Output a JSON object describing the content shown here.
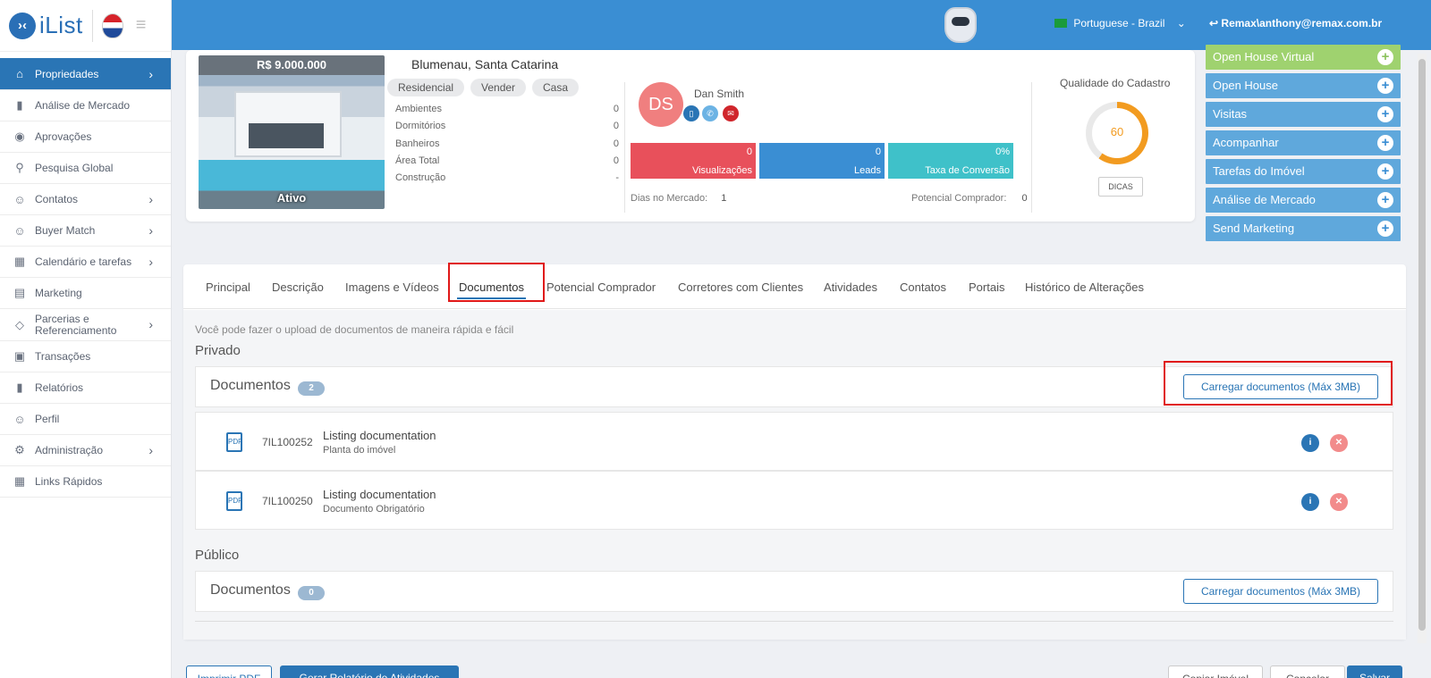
{
  "sidebar": {
    "logo_text": "iList",
    "items": [
      {
        "label": "Propriedades",
        "icon": "home-icon"
      },
      {
        "label": "Análise de Mercado",
        "icon": "bar-chart-icon"
      },
      {
        "label": "Aprovações",
        "icon": "eye-icon"
      },
      {
        "label": "Pesquisa Global",
        "icon": "search-icon"
      },
      {
        "label": "Contatos",
        "icon": "contacts-icon"
      },
      {
        "label": "Buyer Match",
        "icon": "user-icon"
      },
      {
        "label": "Calendário e tarefas",
        "icon": "calendar-icon"
      },
      {
        "label": "Marketing",
        "icon": "book-icon"
      },
      {
        "label_line1": "Parcerias e",
        "label_line2": "Referenciamento",
        "icon": "handshake-icon"
      },
      {
        "label": "Transações",
        "icon": "briefcase-icon"
      },
      {
        "label": "Relatórios",
        "icon": "report-icon"
      },
      {
        "label": "Perfil",
        "icon": "profile-icon"
      },
      {
        "label": "Administração",
        "icon": "gear-icon"
      },
      {
        "label": "Links Rápidos",
        "icon": "links-icon"
      }
    ]
  },
  "header": {
    "language": "Portuguese - Brazil",
    "user": "Remax\\anthony@remax.com.br",
    "colors": {
      "header": "#3a8ed3",
      "accent": "#2a75b5"
    }
  },
  "property": {
    "price": "R$ 9.000.000",
    "status": "Ativo",
    "location": "Blumenau, Santa Catarina",
    "tags": [
      "Residencial",
      "Vender",
      "Casa"
    ],
    "attributes": [
      {
        "label": "Ambientes",
        "value": "0"
      },
      {
        "label": "Dormitórios",
        "value": "0"
      },
      {
        "label": "Banheiros",
        "value": "0"
      },
      {
        "label": "Área Total",
        "value": "0"
      },
      {
        "label": "Construção",
        "value": "-"
      }
    ],
    "agent": {
      "initials": "DS",
      "name": "Dan Smith"
    },
    "stats": [
      {
        "value": "0",
        "label": "Visualizações",
        "color": "#e8505b"
      },
      {
        "value": "0",
        "label": "Leads",
        "color": "#3a8ed3"
      },
      {
        "value": "0%",
        "label": "Taxa de Conversão",
        "color": "#3fc1c9"
      }
    ],
    "days_label": "Dias no Mercado:",
    "days_value": "1",
    "potential_label": "Potencial Comprador:",
    "potential_value": "0",
    "quality_title": "Qualidade do Cadastro",
    "quality_score": "60",
    "quality_fraction": 0.6,
    "tips_button": "DICAS"
  },
  "actions": [
    "Open House Virtual",
    "Open House",
    "Visitas",
    "Acompanhar",
    "Tarefas do Imóvel",
    "Análise de Mercado",
    "Send Marketing"
  ],
  "tabs": [
    "Principal",
    "Descrição",
    "Imagens e Vídeos",
    "Documentos",
    "Potencial Comprador",
    "Corretores com Clientes",
    "Atividades",
    "Contatos",
    "Portais",
    "Histórico de Alterações"
  ],
  "documents": {
    "hint": "Você pode fazer o upload de documentos de maneira rápida e fácil",
    "private_title": "Privado",
    "public_title": "Público",
    "bar_title": "Documentos",
    "private_count": "2",
    "public_count": "0",
    "upload_label": "Carregar documentos (Máx 3MB)",
    "rows": [
      {
        "code": "7IL100252",
        "title": "Listing documentation",
        "subtitle": "Planta do imóvel"
      },
      {
        "code": "7IL100250",
        "title": "Listing documentation",
        "subtitle": "Documento Obrigatório"
      }
    ]
  },
  "footer": {
    "print_pdf": "Imprimir PDF",
    "activity_report": "Gerar Relatório de Atividades",
    "copy": "Copiar Imóvel",
    "cancel": "Cancelar",
    "save": "Salvar"
  }
}
